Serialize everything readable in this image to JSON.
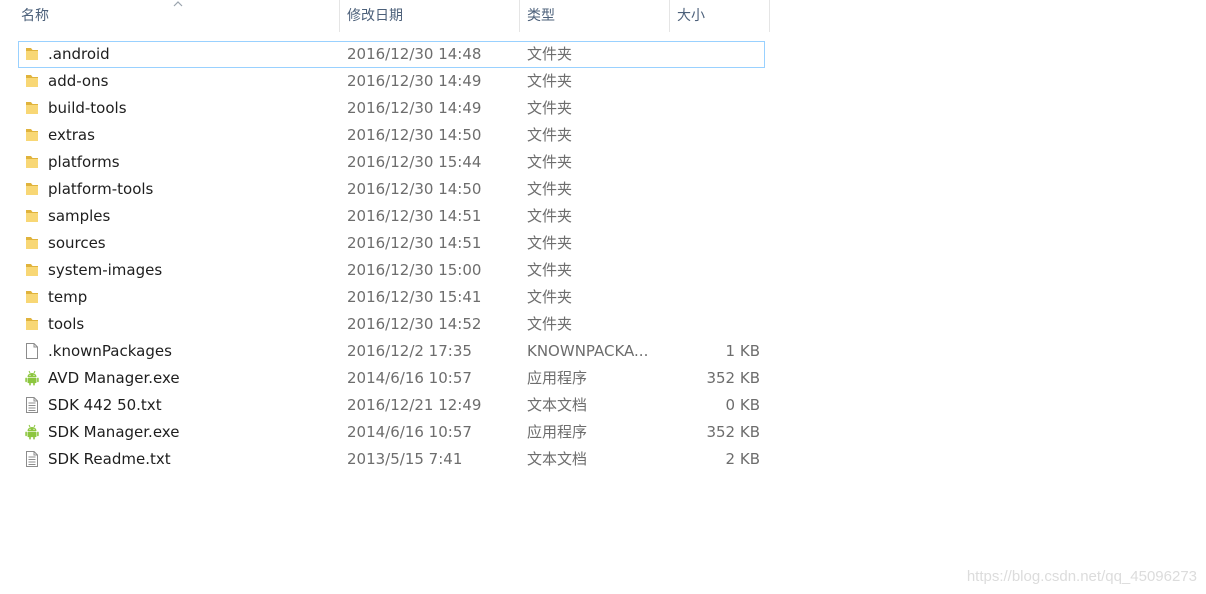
{
  "columns": {
    "name": "名称",
    "date": "修改日期",
    "type": "类型",
    "size": "大小"
  },
  "sort": {
    "column": "name",
    "direction": "ascending",
    "icon": "sort-ascending-icon"
  },
  "files": [
    {
      "name": ".android",
      "date": "2016/12/30 14:48",
      "type": "文件夹",
      "size": "",
      "icon": "folder-icon",
      "focused": true
    },
    {
      "name": "add-ons",
      "date": "2016/12/30 14:49",
      "type": "文件夹",
      "size": "",
      "icon": "folder-icon"
    },
    {
      "name": "build-tools",
      "date": "2016/12/30 14:49",
      "type": "文件夹",
      "size": "",
      "icon": "folder-icon"
    },
    {
      "name": "extras",
      "date": "2016/12/30 14:50",
      "type": "文件夹",
      "size": "",
      "icon": "folder-icon"
    },
    {
      "name": "platforms",
      "date": "2016/12/30 15:44",
      "type": "文件夹",
      "size": "",
      "icon": "folder-icon"
    },
    {
      "name": "platform-tools",
      "date": "2016/12/30 14:50",
      "type": "文件夹",
      "size": "",
      "icon": "folder-icon"
    },
    {
      "name": "samples",
      "date": "2016/12/30 14:51",
      "type": "文件夹",
      "size": "",
      "icon": "folder-icon"
    },
    {
      "name": "sources",
      "date": "2016/12/30 14:51",
      "type": "文件夹",
      "size": "",
      "icon": "folder-icon"
    },
    {
      "name": "system-images",
      "date": "2016/12/30 15:00",
      "type": "文件夹",
      "size": "",
      "icon": "folder-icon"
    },
    {
      "name": "temp",
      "date": "2016/12/30 15:41",
      "type": "文件夹",
      "size": "",
      "icon": "folder-icon"
    },
    {
      "name": "tools",
      "date": "2016/12/30 14:52",
      "type": "文件夹",
      "size": "",
      "icon": "folder-icon"
    },
    {
      "name": ".knownPackages",
      "date": "2016/12/2 17:35",
      "type": "KNOWNPACKA...",
      "size": "1 KB",
      "icon": "blank-file-icon"
    },
    {
      "name": "AVD Manager.exe",
      "date": "2014/6/16 10:57",
      "type": "应用程序",
      "size": "352 KB",
      "icon": "android-icon"
    },
    {
      "name": "SDK 442 50.txt",
      "date": "2016/12/21 12:49",
      "type": "文本文档",
      "size": "0 KB",
      "icon": "text-file-icon"
    },
    {
      "name": "SDK Manager.exe",
      "date": "2014/6/16 10:57",
      "type": "应用程序",
      "size": "352 KB",
      "icon": "android-icon"
    },
    {
      "name": "SDK Readme.txt",
      "date": "2013/5/15 7:41",
      "type": "文本文档",
      "size": "2 KB",
      "icon": "text-file-icon"
    }
  ],
  "watermark": "https://blog.csdn.net/qq_45096273",
  "colors": {
    "header_text": "#4c607a",
    "focus_border": "#99d1ff",
    "folder": "#f8d775",
    "folder_dark": "#e0b33c",
    "android_green": "#8cc63f",
    "secondary_text": "#6d6d6d"
  }
}
